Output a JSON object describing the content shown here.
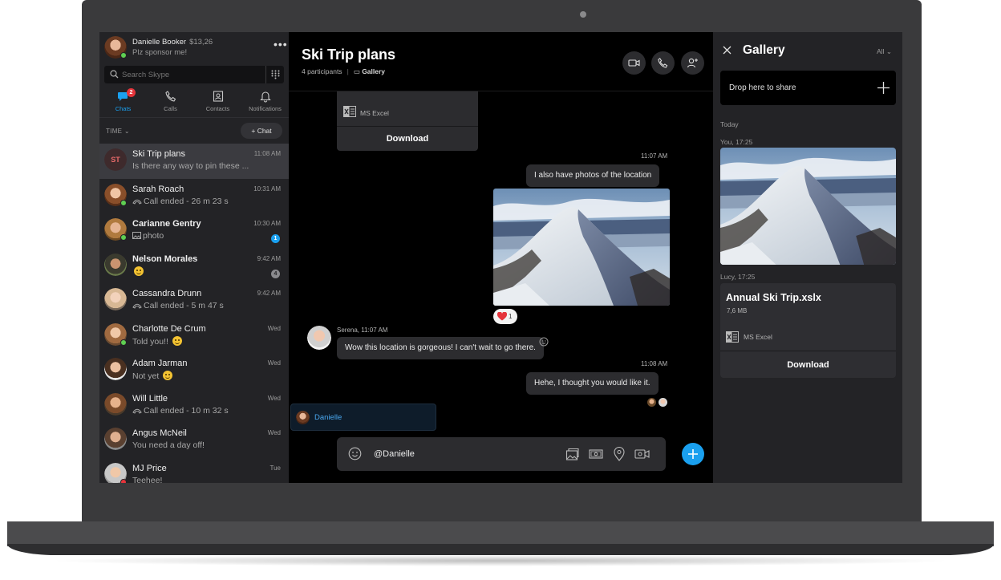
{
  "profile": {
    "name": "Danielle Booker",
    "credit": "$13,26",
    "mood": "Plz sponsor me!"
  },
  "search": {
    "placeholder": "Search Skype"
  },
  "nav": {
    "tabs": [
      {
        "label": "Chats",
        "badge": "2"
      },
      {
        "label": "Calls"
      },
      {
        "label": "Contacts"
      },
      {
        "label": "Notifications"
      }
    ]
  },
  "list_header": {
    "sort_label": "TIME",
    "new_chat_label": "Chat"
  },
  "chats": [
    {
      "name": "Ski Trip plans",
      "initials": "ST",
      "time": "11:08 AM",
      "preview": "Is there any way to pin these ..."
    },
    {
      "name": "Sarah Roach",
      "time": "10:31 AM",
      "preview": "Call ended - 26 m 23 s"
    },
    {
      "name": "Carianne Gentry",
      "time": "10:30 AM",
      "preview": "photo",
      "unread": "1"
    },
    {
      "name": "Nelson Morales",
      "time": "9:42 AM",
      "preview": "",
      "unread": "4"
    },
    {
      "name": "Cassandra Drunn",
      "time": "9:42 AM",
      "preview": "Call ended - 5 m 47 s"
    },
    {
      "name": "Charlotte De Crum",
      "time": "Wed",
      "preview": "Told you!!"
    },
    {
      "name": "Adam Jarman",
      "time": "Wed",
      "preview": "Not yet"
    },
    {
      "name": "Will Little",
      "time": "Wed",
      "preview": "Call ended - 10 m 32 s"
    },
    {
      "name": "Angus McNeil",
      "time": "Wed",
      "preview": "You need a day off!"
    },
    {
      "name": "MJ Price",
      "time": "Tue",
      "preview": "Teehee!"
    }
  ],
  "conversation": {
    "title": "Ski Trip plans",
    "participants": "4 participants",
    "gallery_link": "Gallery",
    "file_card": {
      "app": "MS Excel",
      "download_label": "Download"
    },
    "messages": [
      {
        "time": "11:07 AM",
        "text": "I also have photos of the location"
      },
      {
        "reaction_count": "1"
      },
      {
        "sender": "Serena, 11:07 AM",
        "text": "Wow this location is gorgeous! I can't wait to go there."
      },
      {
        "time": "11:08 AM",
        "text": "Hehe, I thought you would like it."
      }
    ],
    "mention_suggestion": "Danielle",
    "composer_value": "@Danielle"
  },
  "gallery": {
    "title": "Gallery",
    "filter": "All",
    "drop_label": "Drop here to share",
    "section": "Today",
    "photo_caption": "You, 17:25",
    "file_caption": "Lucy, 17:25",
    "file": {
      "name": "Annual Ski Trip.xslx",
      "size": "7,6 MB",
      "app": "MS Excel",
      "download_label": "Download"
    }
  },
  "colors": {
    "accent": "#1aa0ef",
    "presence": "#5fcf52",
    "badge": "#e5343b"
  }
}
